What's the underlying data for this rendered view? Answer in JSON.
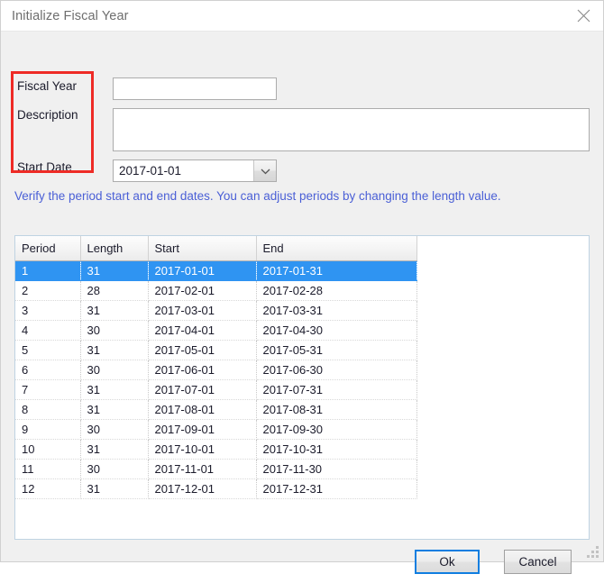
{
  "window": {
    "title": "Initialize Fiscal Year",
    "close_icon": "close-icon"
  },
  "form": {
    "fiscal_year": {
      "label": "Fiscal Year",
      "value": "",
      "placeholder": ""
    },
    "description": {
      "label": "Description",
      "value": "",
      "placeholder": ""
    },
    "start_date": {
      "label": "Start Date",
      "value": "2017-01-01",
      "dropdown_icon": "chevron-down-icon"
    },
    "highlight_color": "#ee2b26"
  },
  "hint": {
    "text": "Verify the period start and end dates.  You can adjust periods by changing the length value.",
    "color": "#4a5fd6"
  },
  "grid": {
    "columns": [
      "Period",
      "Length",
      "Start",
      "End"
    ],
    "selected_index": 0,
    "selection_color": "#2f94f2",
    "rows": [
      {
        "period": "1",
        "length": "31",
        "start": "2017-01-01",
        "end": "2017-01-31"
      },
      {
        "period": "2",
        "length": "28",
        "start": "2017-02-01",
        "end": "2017-02-28"
      },
      {
        "period": "3",
        "length": "31",
        "start": "2017-03-01",
        "end": "2017-03-31"
      },
      {
        "period": "4",
        "length": "30",
        "start": "2017-04-01",
        "end": "2017-04-30"
      },
      {
        "period": "5",
        "length": "31",
        "start": "2017-05-01",
        "end": "2017-05-31"
      },
      {
        "period": "6",
        "length": "30",
        "start": "2017-06-01",
        "end": "2017-06-30"
      },
      {
        "period": "7",
        "length": "31",
        "start": "2017-07-01",
        "end": "2017-07-31"
      },
      {
        "period": "8",
        "length": "31",
        "start": "2017-08-01",
        "end": "2017-08-31"
      },
      {
        "period": "9",
        "length": "30",
        "start": "2017-09-01",
        "end": "2017-09-30"
      },
      {
        "period": "10",
        "length": "31",
        "start": "2017-10-01",
        "end": "2017-10-31"
      },
      {
        "period": "11",
        "length": "30",
        "start": "2017-11-01",
        "end": "2017-11-30"
      },
      {
        "period": "12",
        "length": "31",
        "start": "2017-12-01",
        "end": "2017-12-31"
      }
    ]
  },
  "footer": {
    "ok_label": "Ok",
    "cancel_label": "Cancel",
    "ok_focused": true
  }
}
